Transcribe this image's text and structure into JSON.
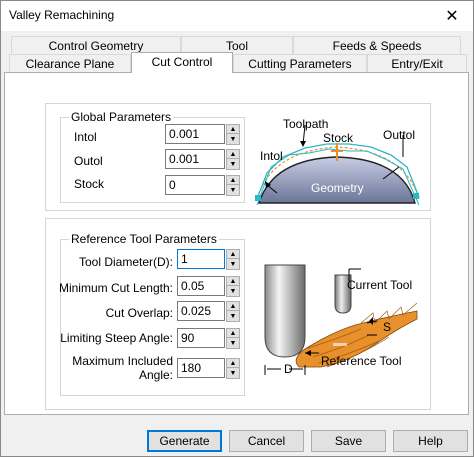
{
  "window": {
    "title": "Valley Remachining",
    "close_glyph": "✕"
  },
  "tabs": {
    "row1": [
      {
        "label": "Control Geometry"
      },
      {
        "label": "Tool"
      },
      {
        "label": "Feeds & Speeds"
      }
    ],
    "row2": [
      {
        "label": "Clearance Plane"
      },
      {
        "label": "Cut Control",
        "active": true
      },
      {
        "label": "Cutting Parameters"
      },
      {
        "label": "Entry/Exit"
      }
    ]
  },
  "global_parameters": {
    "title": "Global Parameters",
    "fields": [
      {
        "label": "Intol",
        "value": "0.001"
      },
      {
        "label": "Outol",
        "value": "0.001"
      },
      {
        "label": "Stock",
        "value": "0"
      }
    ],
    "diagram": {
      "toolpath": "Toolpath",
      "stock": "Stock",
      "outtol": "Outtol",
      "intol": "Intol",
      "geometry": "Geometry"
    }
  },
  "reference_tool_parameters": {
    "title": "Reference Tool Parameters",
    "fields": [
      {
        "label": "Tool  Diameter(D):",
        "value": "1"
      },
      {
        "label": "Minimum Cut Length:",
        "value": "0.05"
      },
      {
        "label": "Cut Overlap:",
        "value": "0.025"
      },
      {
        "label": "Limiting Steep Angle:",
        "value": "90"
      },
      {
        "label": "Maximum Included",
        "label2": "Angle:",
        "value": "180"
      }
    ],
    "diagram": {
      "current_tool": "Current Tool",
      "reference_tool": "Reference Tool",
      "s": "S",
      "d": "D"
    }
  },
  "spin_glyphs": {
    "up": "▲",
    "down": "▼"
  },
  "buttons": {
    "generate": "Generate",
    "cancel": "Cancel",
    "save": "Save",
    "help": "Help"
  },
  "colors": {
    "accent": "#0078d7",
    "orange": "#e8912c",
    "toolpath_cyan": "#2ab7c8"
  }
}
